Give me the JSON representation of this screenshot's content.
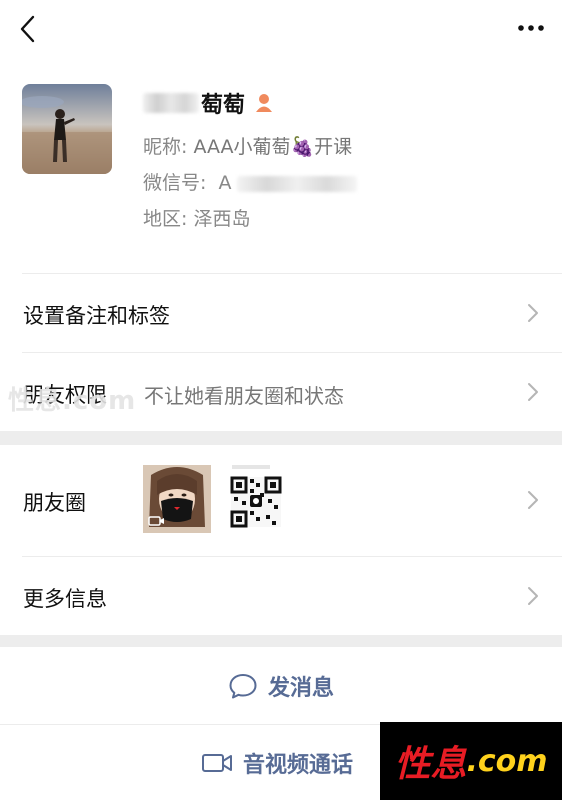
{
  "profile": {
    "name": "萄萄",
    "nickname_label": "昵称:",
    "nickname": "AAA小葡萄🍇开课",
    "wechat_label": "微信号:",
    "wechat_partial": "A",
    "region_label": "地区:",
    "region": "泽西岛"
  },
  "rows": {
    "remark": "设置备注和标签",
    "permission_label": "朋友权限",
    "permission_value": "不让她看朋友圈和状态",
    "moments": "朋友圈",
    "more_info": "更多信息"
  },
  "actions": {
    "message": "发消息",
    "call": "音视频通话"
  },
  "watermarks": {
    "left": "性息.com",
    "brand_cn": "性息",
    "brand_en": ".com"
  },
  "colors": {
    "link_blue": "#576b95",
    "gender_icon": "#f08a5d",
    "separator": "#ededed"
  }
}
